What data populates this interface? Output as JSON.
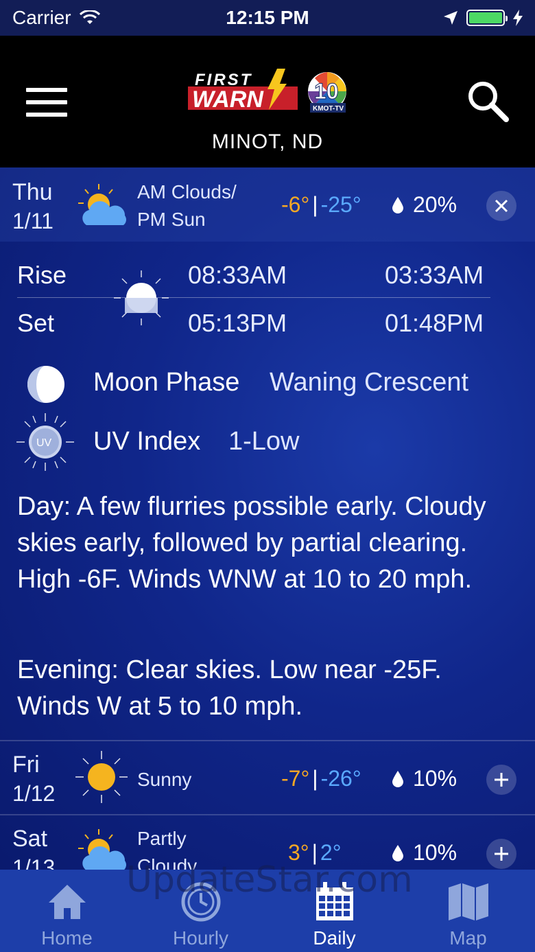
{
  "status_bar": {
    "carrier": "Carrier",
    "time": "12:15 PM"
  },
  "header": {
    "logo_text_first": "FIRST",
    "logo_text_warn": "WARN",
    "station_number": "10",
    "station_call": "KMOT-TV",
    "location": "MINOT, ND"
  },
  "expanded_day": {
    "day": "Thu",
    "date": "1/11",
    "condition_line1": "AM Clouds/",
    "condition_line2": "PM Sun",
    "high": "-6°",
    "low": "-25°",
    "precip": "20%",
    "rise_label": "Rise",
    "set_label": "Set",
    "sunrise": "08:33AM",
    "sunset": "05:13PM",
    "moonrise": "03:33AM",
    "moonset": "01:48PM",
    "moon_phase_label": "Moon Phase",
    "moon_phase_value": "Waning Crescent",
    "uv_label": "UV Index",
    "uv_value": "1-Low",
    "uv_icon_text": "UV",
    "day_text": "Day: A few flurries possible early. Cloudy skies early, followed by partial clearing. High -6F. Winds WNW at 10 to 20 mph.",
    "evening_text": "Evening: Clear skies. Low near -25F. Winds W at 5 to 10 mph."
  },
  "days": [
    {
      "day": "Fri",
      "date": "1/12",
      "condition": "Sunny",
      "high": "-7°",
      "low": "-26°",
      "precip": "10%",
      "icon": "sun-icon"
    },
    {
      "day": "Sat",
      "date": "1/13",
      "condition_line1": "Partly",
      "condition_line2": "Cloudy",
      "high": "3°",
      "low": "2°",
      "precip": "10%",
      "icon": "partly-cloudy-icon"
    }
  ],
  "tabs": [
    {
      "label": "Home",
      "icon": "home-icon"
    },
    {
      "label": "Hourly",
      "icon": "clock-icon"
    },
    {
      "label": "Daily",
      "icon": "calendar-icon",
      "active": true
    },
    {
      "label": "Map",
      "icon": "map-icon"
    }
  ],
  "colors": {
    "high": "#f7a823",
    "low": "#5aa9ff",
    "tab_bar": "#1d3ea9",
    "header": "#000000"
  },
  "watermark": "UpdateStar.com"
}
